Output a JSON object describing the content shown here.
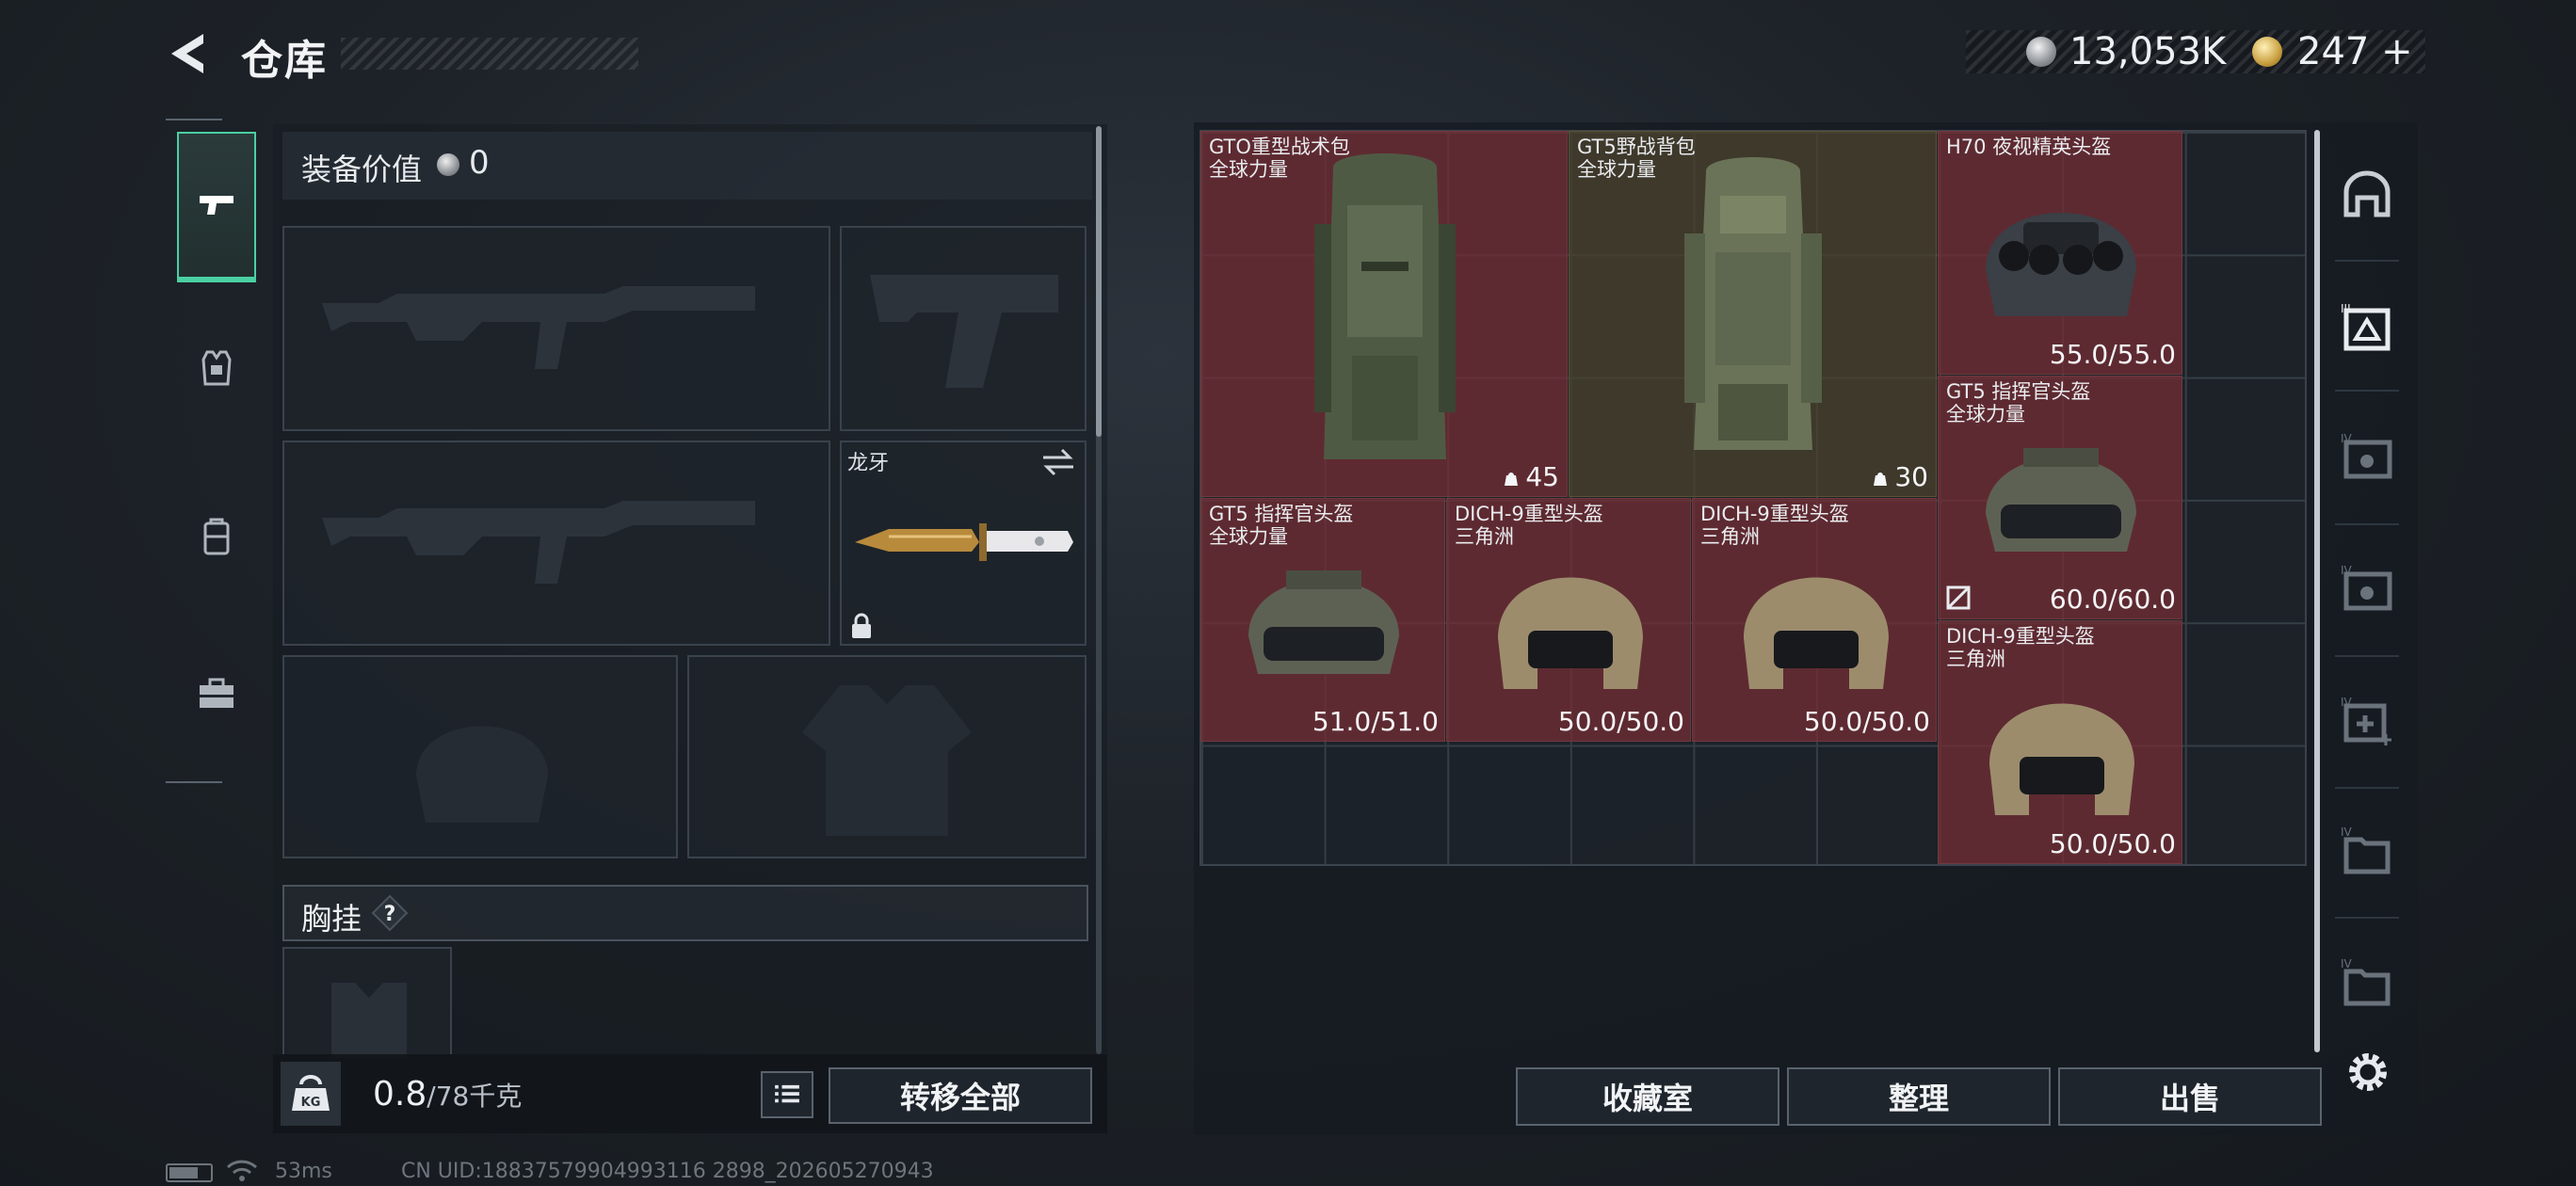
{
  "header": {
    "title": "仓库",
    "currency_coins": "13,053K",
    "currency_gold": "247",
    "gold_plus": "+"
  },
  "left": {
    "tabs": [
      "weapons-tab",
      "armor-tab",
      "backpack-tab",
      "toolbox-tab"
    ],
    "equip_value_label": "装备价值",
    "equip_value": "0",
    "knife_name": "龙牙",
    "chest_label": "胸挂",
    "weight_value": "0.8",
    "weight_capacity": "/78千克",
    "transfer_all": "转移全部"
  },
  "stash": {
    "items": [
      {
        "name": "GTO重型战术包",
        "sub": "全球力量",
        "cap": "45"
      },
      {
        "name": "GT5野战背包",
        "sub": "全球力量",
        "cap": "30"
      },
      {
        "name": "H70 夜视精英头盔",
        "sub": "",
        "dur": "55.0/55.0"
      },
      {
        "name": "GT5 指挥官头盔",
        "sub": "全球力量",
        "dur": "60.0/60.0"
      },
      {
        "name": "GT5 指挥官头盔",
        "sub": "全球力量",
        "dur": "51.0/51.0"
      },
      {
        "name": "DICH-9重型头盔",
        "sub": "三角洲",
        "dur": "50.0/50.0"
      },
      {
        "name": "DICH-9重型头盔",
        "sub": "三角洲",
        "dur": "50.0/50.0"
      },
      {
        "name": "DICH-9重型头盔",
        "sub": "三角洲",
        "dur": "50.0/50.0"
      }
    ]
  },
  "actions": {
    "collection": "收藏室",
    "organize": "整理",
    "sell": "出售"
  },
  "side_icons": [
    "base-icon",
    "case-lv3-icon",
    "case-lv4-icon",
    "case-lv4-b-icon",
    "case-lv4-plus-icon",
    "folder-lv4-icon",
    "folder-lv4-b-icon"
  ],
  "status": {
    "ping": "53ms",
    "uid": "CN UID:18837579904993116 2898_202605270943"
  },
  "colors": {
    "accent": "#4ad0a3",
    "item_red": "#742e34",
    "item_green": "#4a422c"
  }
}
